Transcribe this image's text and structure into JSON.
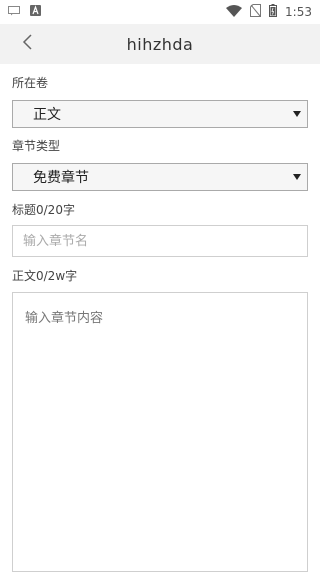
{
  "status_bar": {
    "time": "1:53",
    "icons": [
      "message-icon",
      "a-badge-icon",
      "wifi-icon",
      "no-sim-icon",
      "battery-icon"
    ]
  },
  "nav": {
    "back_icon": "chevron-left-icon",
    "title": "hihzhda"
  },
  "form": {
    "volume_label": "所在卷",
    "volume_value": "正文",
    "chapter_type_label": "章节类型",
    "chapter_type_value": "免费章节",
    "title_label": "标题0/20字",
    "title_placeholder": "输入章节名",
    "body_label": "正文0/2w字",
    "body_placeholder": "输入章节内容"
  },
  "colors": {
    "nav_background": "#f2f2f2",
    "select_background": "#f6f6f6",
    "border": "#cfcfcf"
  }
}
